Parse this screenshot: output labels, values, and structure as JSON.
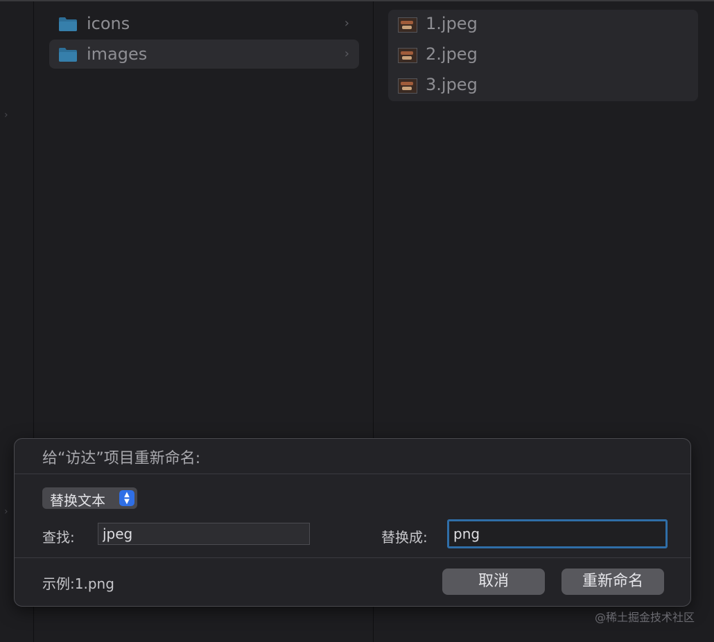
{
  "columns": {
    "folders": [
      {
        "label": "icons",
        "icon": "folder-icon",
        "selected": false
      },
      {
        "label": "images",
        "icon": "folder-icon",
        "selected": true
      }
    ],
    "files": [
      {
        "label": "1.jpeg",
        "icon": "image-thumbnail-icon"
      },
      {
        "label": "2.jpeg",
        "icon": "image-thumbnail-icon"
      },
      {
        "label": "3.jpeg",
        "icon": "image-thumbnail-icon"
      }
    ],
    "chevron": "›"
  },
  "dialog": {
    "title": "给“访达”项目重新命名:",
    "mode": "替换文本",
    "find_label": "查找:",
    "find_value": "jpeg",
    "replace_label": "替换成:",
    "replace_value": "png",
    "example": "示例:1.png",
    "cancel_label": "取消",
    "rename_label": "重新命名"
  },
  "watermark": "@稀土掘金技术社区",
  "colors": {
    "accent": "#2f6fe6",
    "focus_ring": "#2f6ea8",
    "folder": "#2d6f98",
    "background": "#1e1e21"
  }
}
